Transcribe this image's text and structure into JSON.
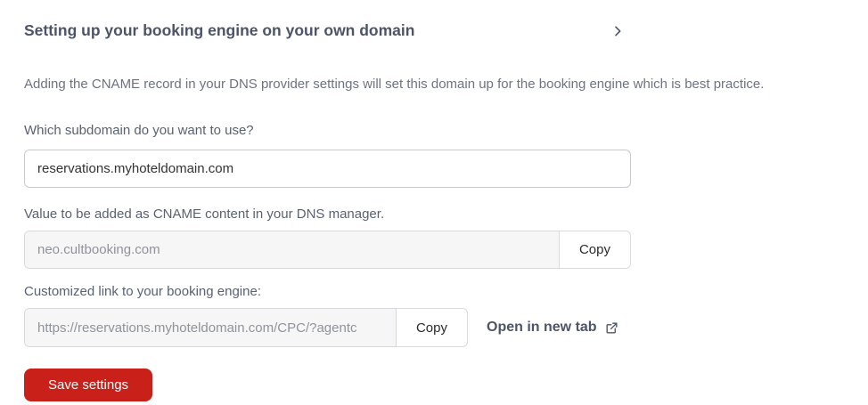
{
  "header": {
    "title": "Setting up your booking engine on your own domain"
  },
  "description": "Adding the CNAME record in your DNS provider settings will set this domain up for the booking engine which is best practice.",
  "subdomain": {
    "label": "Which subdomain do you want to use?",
    "value": "reservations.myhoteldomain.com"
  },
  "cname": {
    "label": "Value to be added as CNAME content in your DNS manager.",
    "value": "neo.cultbooking.com",
    "copy_label": "Copy"
  },
  "custom_link": {
    "label": "Customized link to your booking engine:",
    "value": "https://reservations.myhoteldomain.com/CPC/?agentc",
    "copy_label": "Copy",
    "open_label": "Open in new tab"
  },
  "save": {
    "label": "Save settings"
  },
  "icons": {
    "chevron": "chevron-right-icon",
    "external": "external-link-icon"
  },
  "colors": {
    "save_button_bg": "#c9211a",
    "title_text": "#4d5468",
    "label_text": "#5a6170",
    "muted_input_bg": "#f7f6f6",
    "input_border": "#c6c9ce"
  }
}
